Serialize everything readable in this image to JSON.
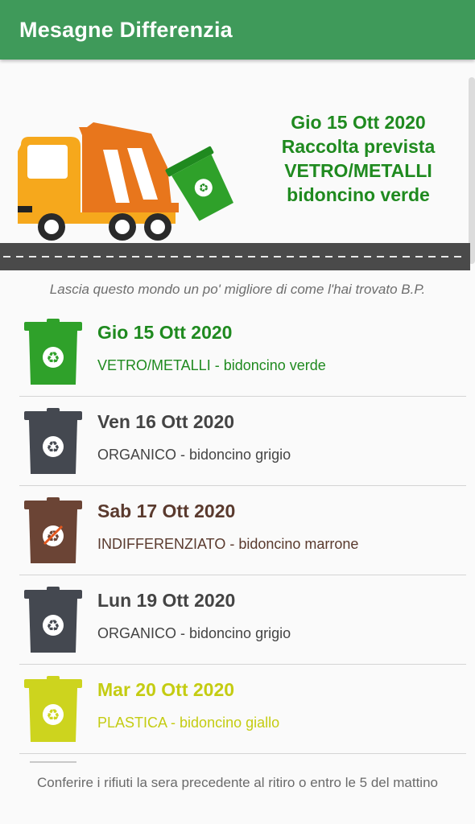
{
  "app": {
    "title": "Mesagne Differenzia"
  },
  "hero": {
    "line1": "Gio 15 Ott 2020",
    "line2": "Raccolta prevista",
    "line3": "VETRO/METALLI",
    "line4": "bidoncino verde",
    "text_color": "#1f8a1f"
  },
  "quote": "Lascia questo mondo un po' migliore di come l'hai trovato B.P.",
  "schedule": [
    {
      "date": "Gio 15 Ott 2020",
      "desc": "VETRO/METALLI - bidoncino verde",
      "color": "#2fa12a",
      "text_color": "#1f8a1f",
      "icon": "recycle-icon"
    },
    {
      "date": "Ven 16 Ott 2020",
      "desc": "ORGANICO - bidoncino grigio",
      "color": "#444850",
      "text_color": "#444444",
      "icon": "recycle-icon"
    },
    {
      "date": "Sab 17 Ott 2020",
      "desc": "INDIFFERENZIATO - bidoncino marrone",
      "color": "#6b4435",
      "text_color": "#5a3a2e",
      "icon": "no-recycle-icon"
    },
    {
      "date": "Lun 19 Ott 2020",
      "desc": "ORGANICO - bidoncino grigio",
      "color": "#444850",
      "text_color": "#444444",
      "icon": "recycle-icon"
    },
    {
      "date": "Mar 20 Ott 2020",
      "desc": "PLASTICA - bidoncino giallo",
      "color": "#cdd41e",
      "text_color": "#c4cc12",
      "icon": "recycle-icon"
    }
  ],
  "footer": "Conferire i rifiuti la sera precedente al ritiro o entro le 5 del mattino",
  "colors": {
    "appbar": "#3f9a5a",
    "road": "#4a4a4a"
  }
}
